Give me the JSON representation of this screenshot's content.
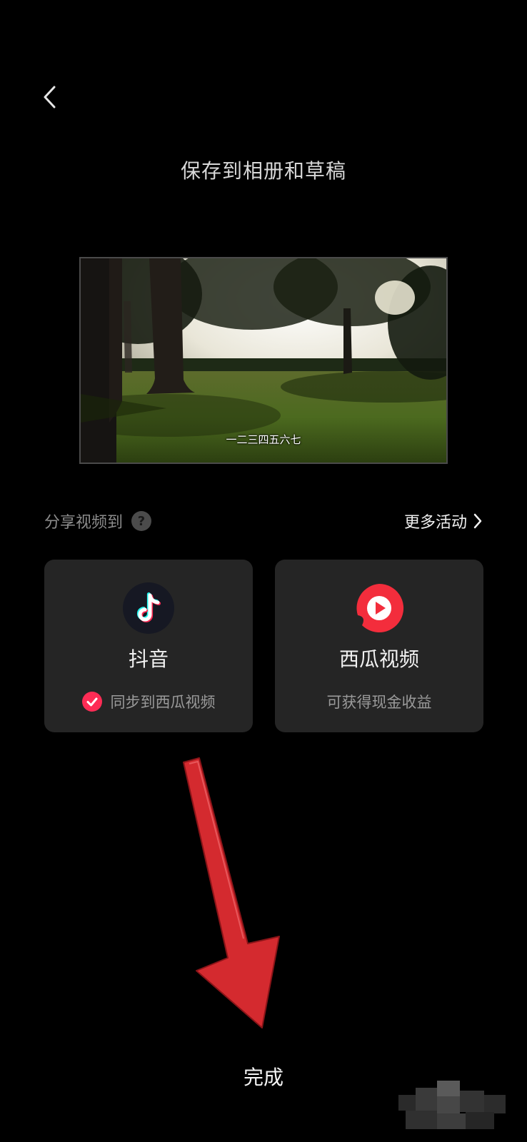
{
  "header": {
    "back_icon": "chevron-left-icon",
    "title": "保存到相册和草稿"
  },
  "preview": {
    "subtitle": "一二三四五六七"
  },
  "share": {
    "label": "分享视频到",
    "help_icon_text": "?",
    "more_label": "更多活动",
    "more_icon": "chevron-right-icon"
  },
  "cards": [
    {
      "name": "抖音",
      "icon": "douyin-icon",
      "sync_label": "同步到西瓜视频",
      "sync_checked": true
    },
    {
      "name": "西瓜视频",
      "icon": "xigua-icon",
      "sub": "可获得现金收益"
    }
  ],
  "footer": {
    "done_label": "完成"
  },
  "colors": {
    "background": "#000000",
    "card": "#252525",
    "accent": "#fe2c55",
    "xigua_red": "#f32d3c",
    "arrow": "#d42a2f"
  }
}
